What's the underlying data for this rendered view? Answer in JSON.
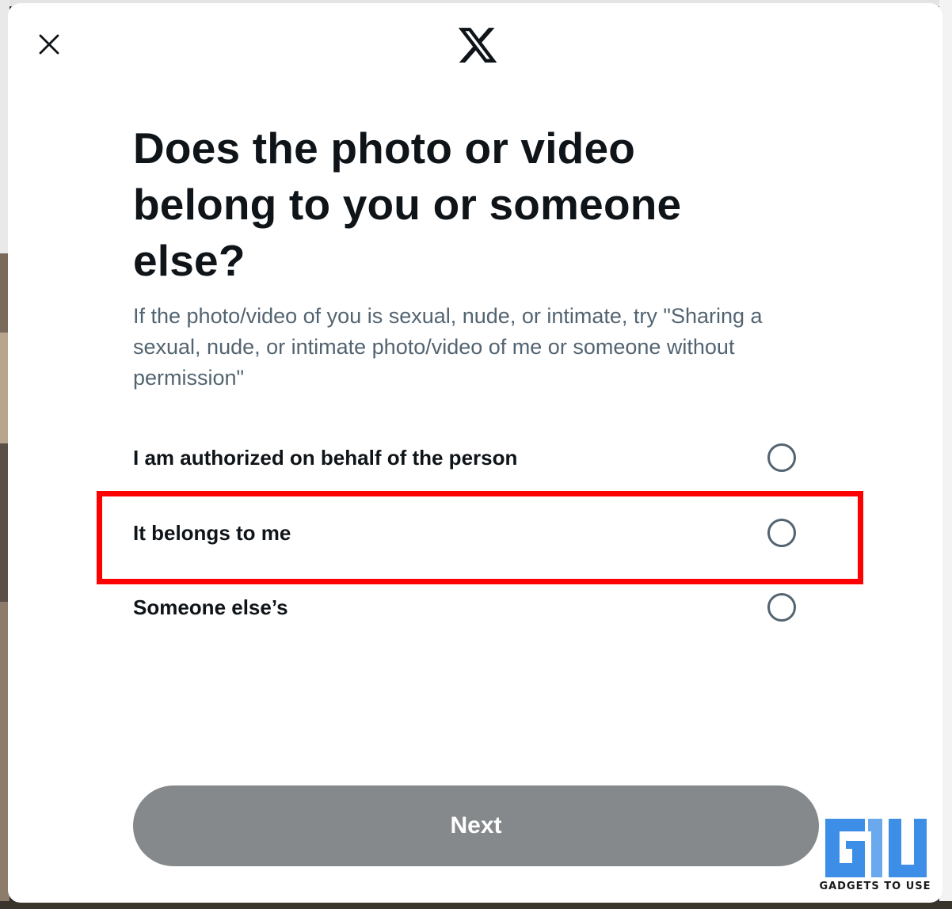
{
  "dialog": {
    "close_icon": "close-icon",
    "logo_icon": "x-logo-icon",
    "title": "Does the photo or video belong to you or someone else?",
    "subtitle": "If the photo/video of you is sexual, nude, or intimate, try \"Sharing a sexual, nude, or intimate photo/video of me or someone without permission\"",
    "options": [
      {
        "label": "I am authorized on behalf of the person",
        "selected": false
      },
      {
        "label": "It belongs to me",
        "selected": false,
        "highlighted": true
      },
      {
        "label": "Someone else’s",
        "selected": false
      }
    ],
    "next_label": "Next",
    "colors": {
      "text": "#0f1419",
      "secondary_text": "#536471",
      "button_disabled": "#86898c",
      "highlight": "#ff0000"
    }
  },
  "watermark": {
    "text": "GADGETS TO USE",
    "colors": {
      "primary": "#3d8ee6",
      "secondary": "#6aa9ee"
    }
  }
}
